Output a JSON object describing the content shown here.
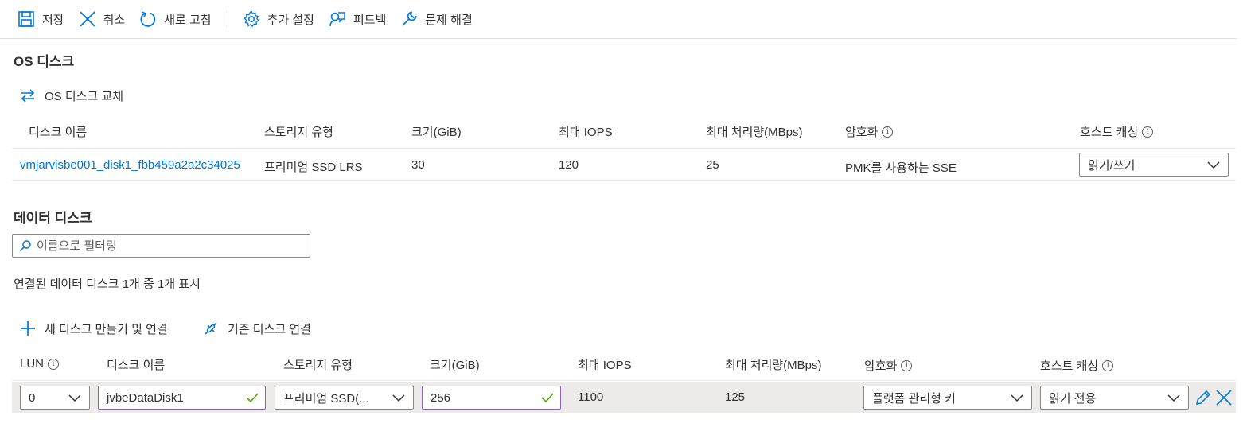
{
  "toolbar": {
    "save": "저장",
    "cancel": "취소",
    "refresh": "새로 고침",
    "settings": "추가 설정",
    "feedback": "피드백",
    "troubleshoot": "문제 해결"
  },
  "os_disk": {
    "title": "OS 디스크",
    "swap_label": "OS 디스크 교체",
    "columns": [
      "디스크 이름",
      "스토리지 유형",
      "크기(GiB)",
      "최대 IOPS",
      "최대 처리량(MBps)",
      "암호화",
      "호스트 캐싱"
    ],
    "row": {
      "name": "vmjarvisbe001_disk1_fbb459a2a2c34025",
      "storage": "프리미엄 SSD LRS",
      "size": "30",
      "iops": "120",
      "throughput": "25",
      "encryption": "PMK를 사용하는 SSE",
      "caching": "읽기/쓰기"
    }
  },
  "data_disks": {
    "title": "데이터 디스크",
    "filter_placeholder": "이름으로 필터링",
    "count_text": "연결된 데이터 디스크 1개 중 1개 표시",
    "create_attach": "새 디스크 만들기 및 연결",
    "attach_existing": "기존 디스크 연결",
    "columns": [
      "LUN",
      "디스크 이름",
      "스토리지 유형",
      "크기(GiB)",
      "최대 IOPS",
      "최대 처리량(MBps)",
      "암호화",
      "호스트 캐싱"
    ],
    "row": {
      "lun": "0",
      "name": "jvbeDataDisk1",
      "storage": "프리미엄 SSD(...",
      "size": "256",
      "iops": "1100",
      "throughput": "125",
      "encryption": "플랫폼 관리형 키",
      "caching": "읽기 전용"
    }
  },
  "colors": {
    "accent": "#0078d4",
    "valid_check": "#57a300",
    "edited_border": "#8764b8",
    "row_highlight": "#edebe9"
  }
}
